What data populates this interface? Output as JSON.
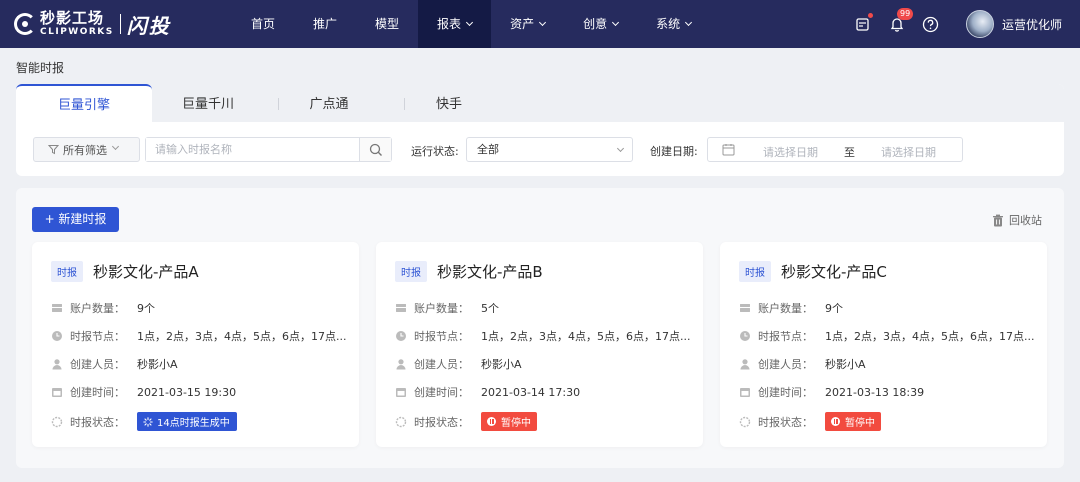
{
  "brand": {
    "name_cn": "秒影工场",
    "name_en": "CLIPWORKS",
    "product": "闪投"
  },
  "nav": [
    {
      "label": "首页",
      "dropdown": false,
      "active": false
    },
    {
      "label": "推广",
      "dropdown": false,
      "active": false
    },
    {
      "label": "模型",
      "dropdown": false,
      "active": false
    },
    {
      "label": "报表",
      "dropdown": true,
      "active": true
    },
    {
      "label": "资产",
      "dropdown": true,
      "active": false
    },
    {
      "label": "创意",
      "dropdown": true,
      "active": false
    },
    {
      "label": "系统",
      "dropdown": true,
      "active": false
    }
  ],
  "header": {
    "notification_count": "99",
    "username": "运营优化师"
  },
  "page_title": "智能时报",
  "tabs": [
    "巨量引擎",
    "巨量千川",
    "广点通",
    "快手"
  ],
  "filters": {
    "all_filters_label": "所有筛选",
    "search_placeholder": "请输入时报名称",
    "status_label": "运行状态:",
    "status_value": "全部",
    "date_label": "创建日期:",
    "date_start_placeholder": "请选择日期",
    "date_to": "至",
    "date_end_placeholder": "请选择日期"
  },
  "actions": {
    "new_button": "+ 新建时报",
    "recycle_bin": "回收站"
  },
  "field_labels": {
    "accounts": "账户数量：",
    "nodes": "时报节点：",
    "creator": "创建人员：",
    "created_at": "创建时间：",
    "status": "时报状态："
  },
  "cards": [
    {
      "tag": "时报",
      "title": "秒影文化-产品A",
      "accounts": "9个",
      "nodes": "1点，2点，3点，4点，5点，6点，17点...",
      "creator": "秒影小A",
      "created_at": "2021-03-15 19:30",
      "status": "14点时报生成中",
      "status_type": "generating"
    },
    {
      "tag": "时报",
      "title": "秒影文化-产品B",
      "accounts": "5个",
      "nodes": "1点，2点，3点，4点，5点，6点，17点...",
      "creator": "秒影小A",
      "created_at": "2021-03-14 17:30",
      "status": "暂停中",
      "status_type": "paused"
    },
    {
      "tag": "时报",
      "title": "秒影文化-产品C",
      "accounts": "9个",
      "nodes": "1点，2点，3点，4点，5点，6点，17点...",
      "creator": "秒影小A",
      "created_at": "2021-03-13 18:39",
      "status": "暂停中",
      "status_type": "paused"
    }
  ],
  "colors": {
    "nav_bg": "#262b5e",
    "primary": "#2f55d4",
    "danger": "#f24b3f",
    "badge": "#f04a4a"
  }
}
